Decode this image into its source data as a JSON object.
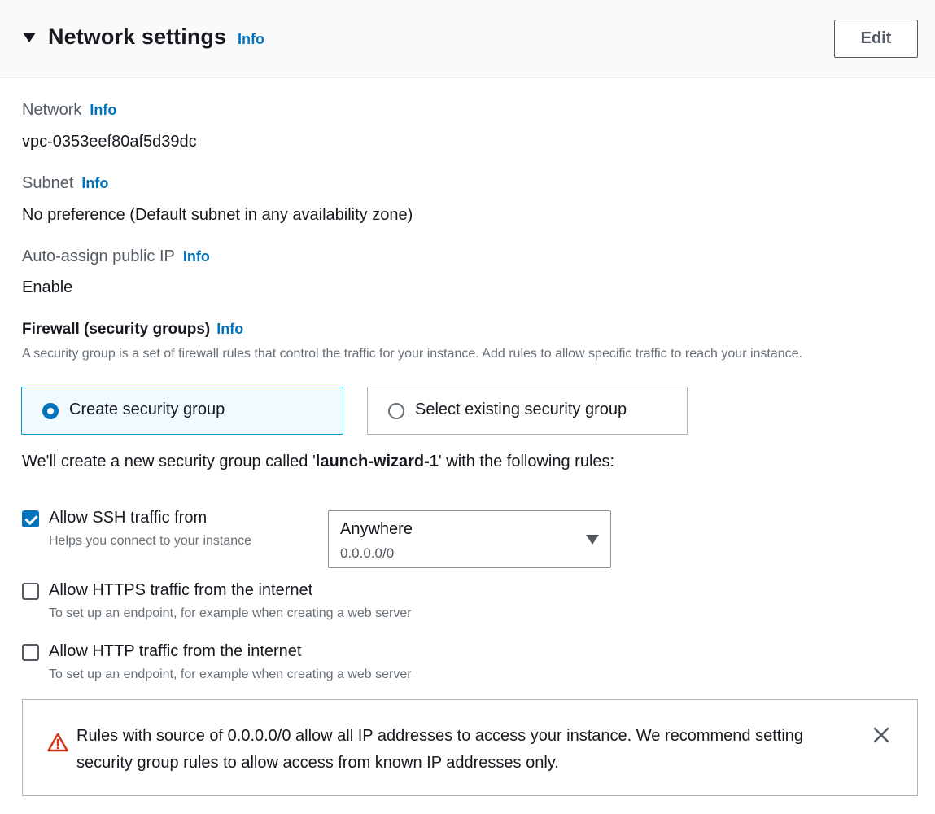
{
  "header": {
    "title": "Network settings",
    "info": "Info",
    "edit_label": "Edit"
  },
  "network": {
    "label": "Network",
    "info": "Info",
    "value": "vpc-0353eef80af5d39dc"
  },
  "subnet": {
    "label": "Subnet",
    "info": "Info",
    "value": "No preference (Default subnet in any availability zone)"
  },
  "public_ip": {
    "label": "Auto-assign public IP",
    "info": "Info",
    "value": "Enable"
  },
  "firewall": {
    "title": "Firewall (security groups)",
    "info": "Info",
    "description": "A security group is a set of firewall rules that control the traffic for your instance. Add rules to allow specific traffic to reach your instance.",
    "options": [
      {
        "label": "Create security group",
        "selected": true
      },
      {
        "label": "Select existing security group",
        "selected": false
      }
    ],
    "create_text_prefix": "We'll create a new security group called '",
    "group_name": "launch-wizard-1",
    "create_text_suffix": "' with the following rules:"
  },
  "rules": {
    "ssh": {
      "label": "Allow SSH traffic from",
      "help": "Helps you connect to your instance",
      "checked": true,
      "select_value": "Anywhere",
      "select_sub": "0.0.0.0/0"
    },
    "https": {
      "label": "Allow HTTPS traffic from the internet",
      "help": "To set up an endpoint, for example when creating a web server",
      "checked": false
    },
    "http": {
      "label": "Allow HTTP traffic from the internet",
      "help": "To set up an endpoint, for example when creating a web server",
      "checked": false
    }
  },
  "alert": {
    "text": "Rules with source of 0.0.0.0/0 allow all IP addresses to access your instance. We recommend setting security group rules to allow access from known IP addresses only.",
    "icon": "warning-icon",
    "dismiss_icon": "close-icon"
  },
  "colors": {
    "info_link": "#0073bb",
    "selected_tile_border": "#00a1c9",
    "selected_tile_bg": "#f1faff",
    "checkbox_checked": "#0073bb",
    "warning": "#d13212"
  }
}
